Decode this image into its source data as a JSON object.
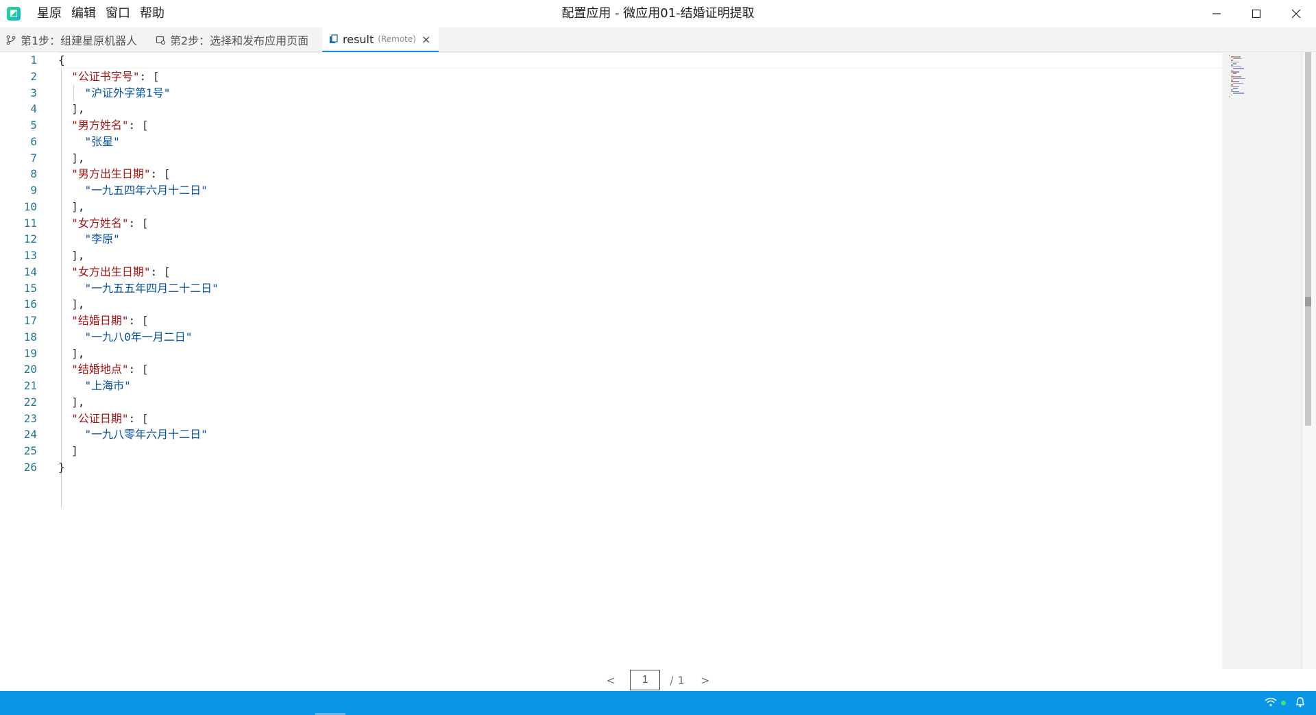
{
  "menu": [
    "星原",
    "编辑",
    "窗口",
    "帮助"
  ],
  "window": {
    "title": "配置应用 - 微应用01-结婚证明提取"
  },
  "tabs": [
    {
      "label": "第1步：组建星原机器人",
      "icon": "branch-icon"
    },
    {
      "label": "第2步：选择和发布应用页面",
      "icon": "page-refresh-icon"
    },
    {
      "label": "result",
      "badge": "(Remote)",
      "icon": "file-icon",
      "close": "×",
      "active": true
    }
  ],
  "editor": {
    "line_numbers": [
      "1",
      "2",
      "3",
      "4",
      "5",
      "6",
      "7",
      "8",
      "9",
      "10",
      "11",
      "12",
      "13",
      "14",
      "15",
      "16",
      "17",
      "18",
      "19",
      "20",
      "21",
      "22",
      "23",
      "24",
      "25",
      "26"
    ],
    "lines": [
      [
        {
          "t": "{",
          "c": "punc"
        }
      ],
      [
        {
          "t": "  "
        },
        {
          "t": "\"公证书字号\"",
          "c": "key"
        },
        {
          "t": ": [",
          "c": "punc"
        }
      ],
      [
        {
          "t": "    "
        },
        {
          "t": "\"沪证外字第1号\"",
          "c": "str"
        }
      ],
      [
        {
          "t": "  "
        },
        {
          "t": "],",
          "c": "punc"
        }
      ],
      [
        {
          "t": "  "
        },
        {
          "t": "\"男方姓名\"",
          "c": "key"
        },
        {
          "t": ": [",
          "c": "punc"
        }
      ],
      [
        {
          "t": "    "
        },
        {
          "t": "\"张星\"",
          "c": "str"
        }
      ],
      [
        {
          "t": "  "
        },
        {
          "t": "],",
          "c": "punc"
        }
      ],
      [
        {
          "t": "  "
        },
        {
          "t": "\"男方出生日期\"",
          "c": "key"
        },
        {
          "t": ": [",
          "c": "punc"
        }
      ],
      [
        {
          "t": "    "
        },
        {
          "t": "\"一九五四年六月十二日\"",
          "c": "str"
        }
      ],
      [
        {
          "t": "  "
        },
        {
          "t": "],",
          "c": "punc"
        }
      ],
      [
        {
          "t": "  "
        },
        {
          "t": "\"女方姓名\"",
          "c": "key"
        },
        {
          "t": ": [",
          "c": "punc"
        }
      ],
      [
        {
          "t": "    "
        },
        {
          "t": "\"李原\"",
          "c": "str"
        }
      ],
      [
        {
          "t": "  "
        },
        {
          "t": "],",
          "c": "punc"
        }
      ],
      [
        {
          "t": "  "
        },
        {
          "t": "\"女方出生日期\"",
          "c": "key"
        },
        {
          "t": ": [",
          "c": "punc"
        }
      ],
      [
        {
          "t": "    "
        },
        {
          "t": "\"一九五五年四月二十二日\"",
          "c": "str"
        }
      ],
      [
        {
          "t": "  "
        },
        {
          "t": "],",
          "c": "punc"
        }
      ],
      [
        {
          "t": "  "
        },
        {
          "t": "\"结婚日期\"",
          "c": "key"
        },
        {
          "t": ": [",
          "c": "punc"
        }
      ],
      [
        {
          "t": "    "
        },
        {
          "t": "\"一九八0年一月二日\"",
          "c": "str"
        }
      ],
      [
        {
          "t": "  "
        },
        {
          "t": "],",
          "c": "punc"
        }
      ],
      [
        {
          "t": "  "
        },
        {
          "t": "\"结婚地点\"",
          "c": "key"
        },
        {
          "t": ": [",
          "c": "punc"
        }
      ],
      [
        {
          "t": "    "
        },
        {
          "t": "\"上海市\"",
          "c": "str"
        }
      ],
      [
        {
          "t": "  "
        },
        {
          "t": "],",
          "c": "punc"
        }
      ],
      [
        {
          "t": "  "
        },
        {
          "t": "\"公证日期\"",
          "c": "key"
        },
        {
          "t": ": [",
          "c": "punc"
        }
      ],
      [
        {
          "t": "    "
        },
        {
          "t": "\"一九八零年六月十二日\"",
          "c": "str"
        }
      ],
      [
        {
          "t": "  "
        },
        {
          "t": "]",
          "c": "punc"
        }
      ],
      [
        {
          "t": "}",
          "c": "punc"
        }
      ]
    ]
  },
  "pager": {
    "prev": "<",
    "current": "1",
    "separator": "/",
    "total": "1",
    "next": ">"
  },
  "colors": {
    "key": "#a31515",
    "string": "#0451a5",
    "line_number": "#237893",
    "status_bar": "#0a96e6"
  },
  "statusbar": {
    "icons": [
      "wifi-icon",
      "bell-icon"
    ]
  }
}
